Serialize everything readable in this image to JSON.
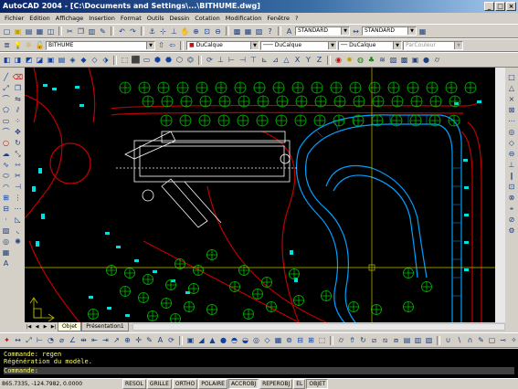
{
  "window": {
    "title": "AutoCAD 2004 - [C:\\Documents and Settings\\...\\BITHUME.dwg]"
  },
  "menu": [
    "Fichier",
    "Edition",
    "Affichage",
    "Insertion",
    "Format",
    "Outils",
    "Dessin",
    "Cotation",
    "Modification",
    "Fenêtre",
    "?"
  ],
  "toolbar": {
    "layer": "BITHUME",
    "color": "DuCalque",
    "linetype": "DuCalque",
    "lineweight": "DuCalque",
    "plotstyle": "ParCouleur",
    "textstyle": "STANDARD",
    "dimstyle": "STANDARD"
  },
  "tabs": [
    "Objet",
    "Présentation1"
  ],
  "command_lines": [
    "Commande: regen",
    "Régénération du modèle.",
    "Commande:"
  ],
  "status": {
    "coords": "865.7335, -124.7982, 0.0000",
    "buttons": [
      "RESOL",
      "GRILLE",
      "ORTHO",
      "POLAIRE",
      "ACCROBJ",
      "REPEROBJ",
      "EL",
      "OBJET"
    ]
  },
  "icons": [
    "new-icon",
    "open-icon",
    "save-icon",
    "print-icon",
    "cut-icon",
    "copy-icon",
    "paste-icon",
    "undo-icon",
    "redo-icon",
    "pan-icon",
    "zoom-icon",
    "properties-icon"
  ],
  "colors": {
    "background": "#000000",
    "tree": "#00c000",
    "road": "#c00000",
    "pool": "#00a0ff",
    "car": "#00e0e0",
    "building": "#ffffff",
    "cursor": "#c0c000"
  }
}
